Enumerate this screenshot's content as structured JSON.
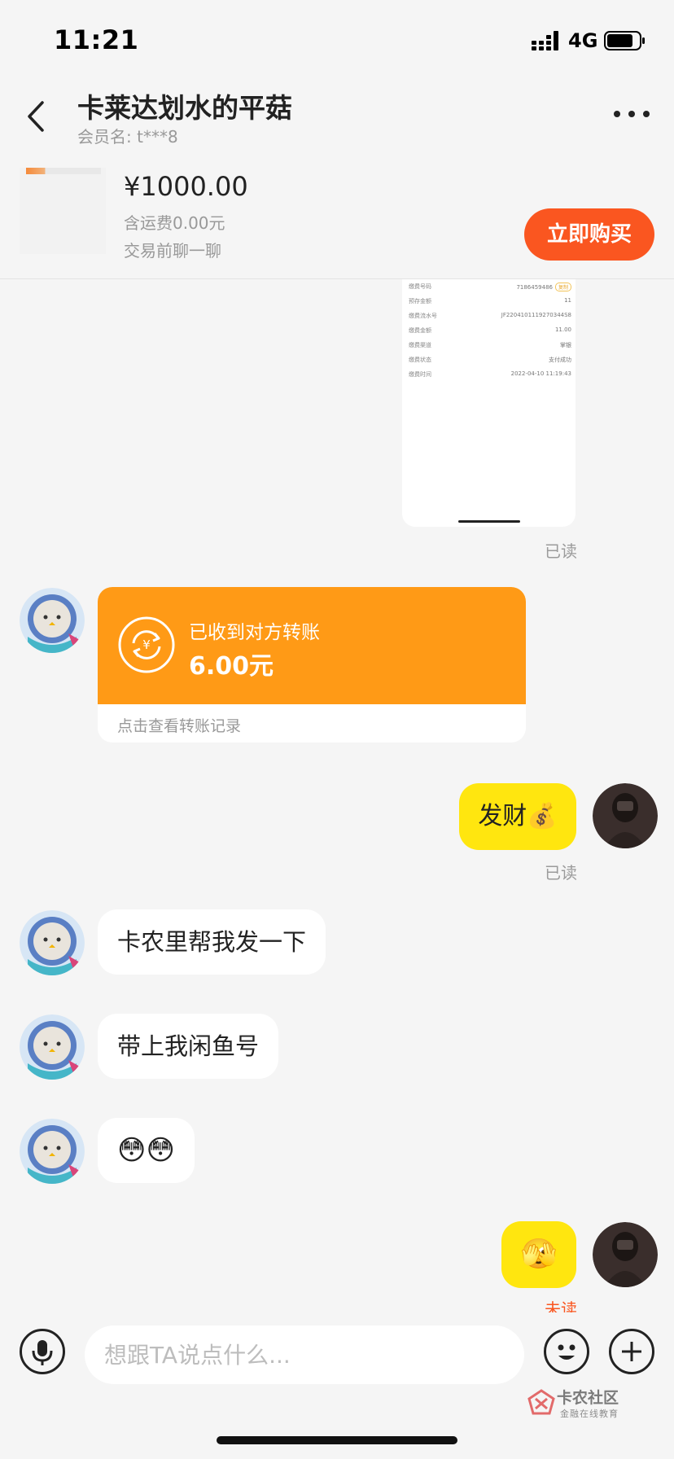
{
  "status_bar": {
    "time": "11:21",
    "network": "4G"
  },
  "header": {
    "title": "卡莱达划水的平菇",
    "member_label": "会员名:",
    "member_name": "t***8"
  },
  "product": {
    "price": "¥1000.00",
    "shipping": "含运费0.00元",
    "note": "交易前聊一聊",
    "buy_label": "立即购买"
  },
  "screenshot_message": {
    "rows": [
      {
        "key": "缴费号码",
        "value": "7186459486",
        "badge": "复制"
      },
      {
        "key": "预存金额",
        "value": "11"
      },
      {
        "key": "缴费流水号",
        "value": "JF2204101119270344S8"
      },
      {
        "key": "缴费金额",
        "value": "11.00"
      },
      {
        "key": "缴费渠道",
        "value": "掌银"
      },
      {
        "key": "缴费状态",
        "value": "支付成功"
      },
      {
        "key": "缴费时间",
        "value": "2022-04-10 11:19:43"
      }
    ]
  },
  "messages": {
    "read_label_1": "已读",
    "transfer": {
      "status": "已收到对方转账",
      "amount": "6.00元",
      "link": "点击查看转账记录"
    },
    "my_msg_1": "发财💰",
    "read_label_2": "已读",
    "their_msg_1": "卡农里帮我发一下",
    "their_msg_2": "带上我闲鱼号",
    "their_msg_3": "😳😳",
    "my_msg_2": "🫣",
    "unread_label": "未读"
  },
  "input": {
    "placeholder": "想跟TA说点什么..."
  },
  "watermark": {
    "name": "卡农社区",
    "sub": "金融在线教育"
  },
  "colors": {
    "accent_orange": "#fa5620",
    "transfer_orange": "#ff9a16",
    "bubble_yellow": "#ffe60f",
    "background": "#f5f5f5"
  }
}
